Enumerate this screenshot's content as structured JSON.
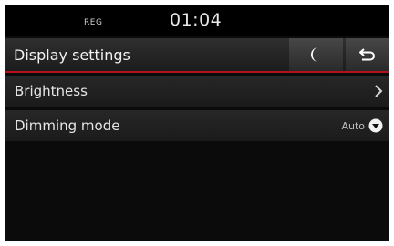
{
  "status_bar": {
    "reg_label": "REG",
    "time": "01:04"
  },
  "header": {
    "title": "Display settings",
    "moon_icon": "crescent-moon-icon",
    "back_icon": "return-arrow-icon"
  },
  "settings": {
    "brightness": {
      "label": "Brightness",
      "icon": "chevron-right-icon"
    },
    "dimming_mode": {
      "label": "Dimming mode",
      "value": "Auto",
      "icon": "dropdown-circle-icon"
    }
  },
  "colors": {
    "accent_line": "#b3121b",
    "background": "#0b0b0b"
  }
}
